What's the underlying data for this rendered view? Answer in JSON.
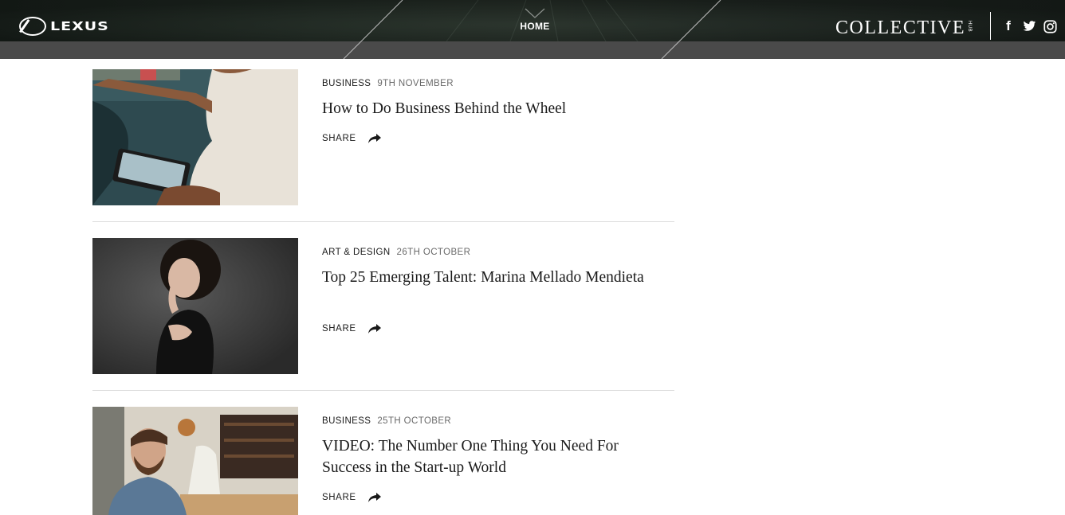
{
  "header": {
    "logo_text": "LEXUS",
    "nav_home": "HOME",
    "brand": "COLLECTIVE",
    "brand_sup": "HUB",
    "social": {
      "facebook": "f",
      "twitter_icon": "twitter-icon",
      "instagram_icon": "instagram-icon"
    }
  },
  "articles": [
    {
      "category": "BUSINESS",
      "date": "9TH NOVEMBER",
      "title": "How to Do Business Behind the Wheel",
      "share_label": "SHARE"
    },
    {
      "category": "ART & DESIGN",
      "date": "26TH OCTOBER",
      "title": "Top 25 Emerging Talent: Marina Mellado Mendieta",
      "share_label": "SHARE"
    },
    {
      "category": "BUSINESS",
      "date": "25TH OCTOBER",
      "title": "VIDEO: The Number One Thing You Need For Success in the Start-up World",
      "share_label": "SHARE"
    }
  ],
  "colors": {
    "header_bg": "#1e2620",
    "subbar": "#4a4a4a",
    "text": "#1a1a1a",
    "date": "#6a6a6a",
    "separator": "#dddddd"
  }
}
